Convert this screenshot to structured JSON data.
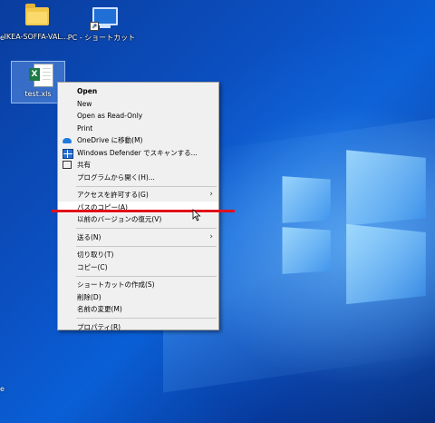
{
  "desktop": {
    "icons": [
      {
        "label": "IKEA-SOFFA-VAL..."
      },
      {
        "label": "PC - ショートカット"
      },
      {
        "label": "test.xls"
      }
    ],
    "left_edge_top": "e",
    "left_edge_bottom": "e"
  },
  "context_menu": {
    "items": [
      {
        "label": "Open",
        "bold": true
      },
      {
        "label": "New"
      },
      {
        "label": "Open as Read-Only"
      },
      {
        "label": "Print"
      },
      {
        "label": "OneDrive に移動(M)",
        "icon": "onedrive-cloud-icon"
      },
      {
        "label": "Windows Defender でスキャンする...",
        "icon": "windows-defender-icon"
      },
      {
        "label": "共有",
        "icon": "share-icon"
      },
      {
        "label": "プログラムから開く(H)..."
      },
      {
        "label": "アクセスを許可する(G)",
        "submenu": true
      },
      {
        "label": "パスのコピー(A)",
        "highlighted": true
      },
      {
        "label": "以前のバージョンの復元(V)"
      },
      {
        "label": "送る(N)",
        "submenu": true
      },
      {
        "label": "切り取り(T)"
      },
      {
        "label": "コピー(C)"
      },
      {
        "label": "ショートカットの作成(S)"
      },
      {
        "label": "削除(D)"
      },
      {
        "label": "名前の変更(M)"
      },
      {
        "label": "プロパティ(R)"
      }
    ]
  },
  "colors": {
    "desktop_blue": "#0b4fc0",
    "menu_bg": "#f0f0f0",
    "annotation_red": "#e0101a"
  }
}
